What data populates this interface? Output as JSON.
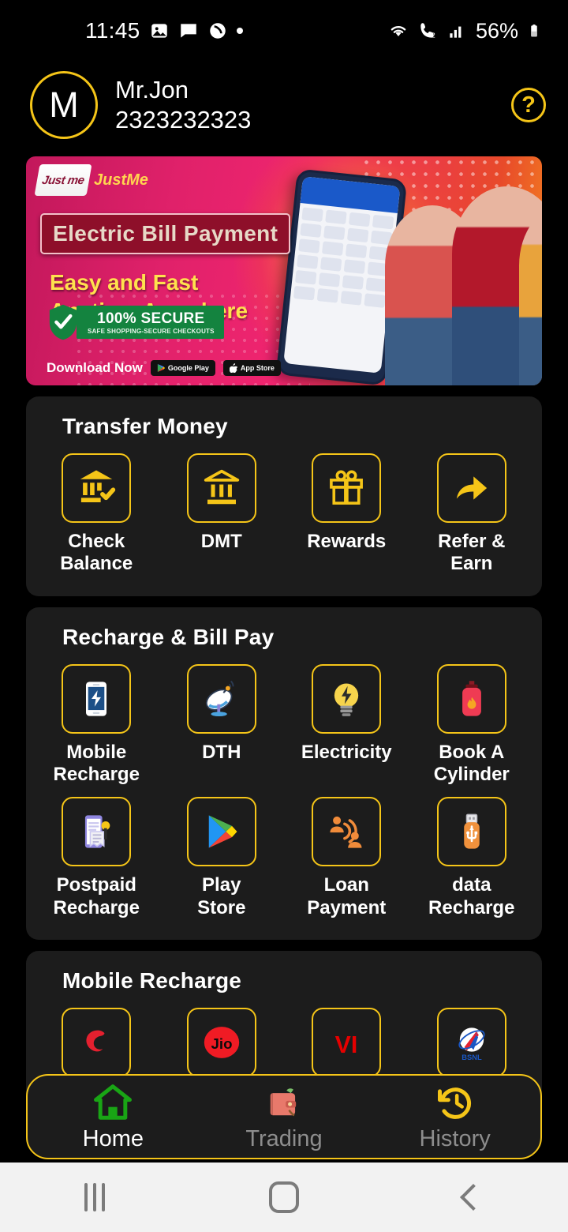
{
  "status_bar": {
    "time": "11:45",
    "battery_percent": "56%",
    "left_icons": [
      "image-icon",
      "message-icon",
      "call-mute-icon",
      "dot-indicator-icon"
    ],
    "right_icons": [
      "wifi-icon",
      "call-forward-icon",
      "signal-bars-icon",
      "battery-icon"
    ]
  },
  "header": {
    "avatar_initial": "M",
    "user_name": "Mr.Jon",
    "user_phone": "2323232323",
    "help_label": "?"
  },
  "banner": {
    "brand": "JustMe",
    "brand_mark": "Just me",
    "title": "Electric Bill Payment",
    "subtitle_line1": "Easy and Fast",
    "subtitle_line2": "Anytime Anywhere",
    "secure_title": "100% SECURE",
    "secure_sub": "SAFE SHOPPING-SECURE CHECKOUTS",
    "download_label": "Download Now",
    "store_google": "Google Play",
    "store_apple": "App Store"
  },
  "sections": [
    {
      "title": "Transfer Money",
      "items": [
        {
          "label_line1": "Check",
          "label_line2": "Balance",
          "icon": "bank-check-icon"
        },
        {
          "label_line1": "DMT",
          "label_line2": "",
          "icon": "bank-icon"
        },
        {
          "label_line1": "Rewards",
          "label_line2": "",
          "icon": "gift-icon"
        },
        {
          "label_line1": "Refer &",
          "label_line2": "Earn",
          "icon": "share-arrow-icon"
        }
      ]
    },
    {
      "title": "Recharge & Bill Pay",
      "items": [
        {
          "label_line1": "Mobile",
          "label_line2": "Recharge",
          "icon": "mobile-bolt-icon"
        },
        {
          "label_line1": "DTH",
          "label_line2": "",
          "icon": "satellite-dish-icon"
        },
        {
          "label_line1": "Electricity",
          "label_line2": "",
          "icon": "lightbulb-bolt-icon"
        },
        {
          "label_line1": "Book A",
          "label_line2": "Cylinder",
          "icon": "gas-cylinder-icon"
        },
        {
          "label_line1": "Postpaid",
          "label_line2": "Recharge",
          "icon": "bill-receipt-icon"
        },
        {
          "label_line1": "Play",
          "label_line2": "Store",
          "icon": "play-store-icon"
        },
        {
          "label_line1": "Loan",
          "label_line2": "Payment",
          "icon": "loan-people-icon"
        },
        {
          "label_line1": "data",
          "label_line2": "Recharge",
          "icon": "usb-drive-icon"
        }
      ]
    },
    {
      "title": "Mobile Recharge",
      "items": [
        {
          "label_line1": "",
          "label_line2": "",
          "icon": "airtel-logo-icon"
        },
        {
          "label_line1": "",
          "label_line2": "",
          "icon": "jio-logo-icon"
        },
        {
          "label_line1": "",
          "label_line2": "",
          "icon": "vi-logo-icon"
        },
        {
          "label_line1": "",
          "label_line2": "",
          "icon": "bsnl-logo-icon"
        }
      ]
    }
  ],
  "bottom_nav": [
    {
      "label": "Home",
      "icon": "home-icon",
      "active": true
    },
    {
      "label": "Trading",
      "icon": "wallet-icon",
      "active": false
    },
    {
      "label": "History",
      "icon": "clock-history-icon",
      "active": false
    }
  ],
  "system_nav": {
    "recents": "recents-icon",
    "home": "home-circle-icon",
    "back": "back-icon"
  },
  "colors": {
    "accent_yellow": "#F5C518",
    "card_bg": "#1c1c1c",
    "page_bg": "#000000",
    "banner_pink": "#e0216a"
  }
}
